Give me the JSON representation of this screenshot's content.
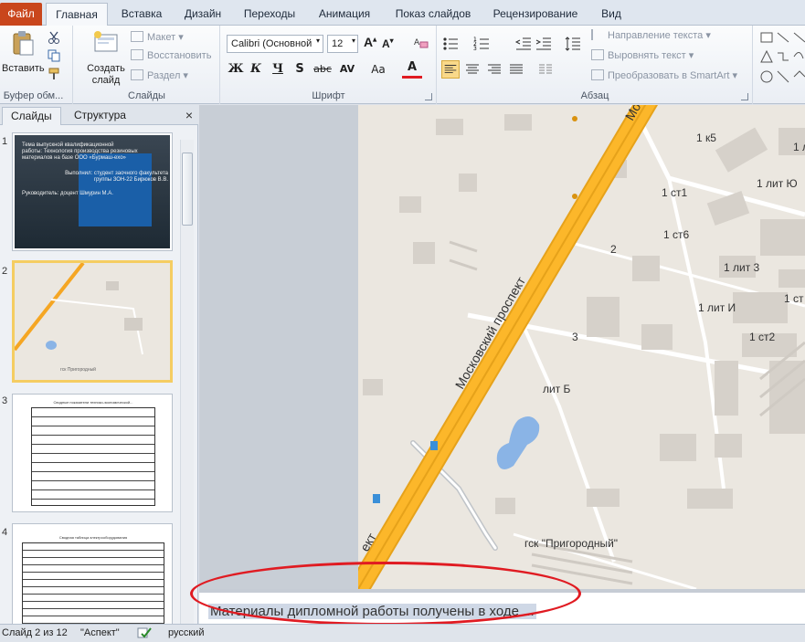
{
  "ribbon": {
    "tabs": [
      "Файл",
      "Главная",
      "Вставка",
      "Дизайн",
      "Переходы",
      "Анимация",
      "Показ слайдов",
      "Рецензирование",
      "Вид"
    ],
    "clipboard": {
      "paste": "Вставить",
      "label": "Буфер обм..."
    },
    "slides": {
      "new_slide": "Создать",
      "new_slide_2": "слайд",
      "layout": "Макет",
      "reset": "Восстановить",
      "section": "Раздел",
      "label": "Слайды"
    },
    "font": {
      "family": "Calibri (Основной",
      "size": "12",
      "label": "Шрифт",
      "bold": "Ж",
      "italic": "К",
      "underline": "Ч",
      "strike": "S",
      "abc": "abc",
      "av": "AV",
      "aa": "Aa",
      "a": "A"
    },
    "paragraph": {
      "text_direction": "Направление текста",
      "align_text": "Выровнять текст",
      "smartart": "Преобразовать в SmartArt",
      "label": "Абзац"
    }
  },
  "slides_pane": {
    "tab_slides": "Слайды",
    "tab_outline": "Структура",
    "close": "×",
    "thumbnails": [
      {
        "num": "1",
        "lines": [
          "Тема выпускной квалификационной",
          "работы: Технология производства резиновых",
          "материалов на базе ООО «Бурмаш-ехо»",
          "Выполнил: студент заочного факультета",
          "группы ЗОН-22 Бирюков В.В.",
          "Руководитель: доцент Шмурин М.А."
        ]
      },
      {
        "num": "2",
        "label": "гск Пригородный"
      },
      {
        "num": "3",
        "title": "Сводные показатели технико-экономической..."
      },
      {
        "num": "4",
        "title": "Сводная таблица электрооборудования"
      }
    ]
  },
  "map": {
    "street": "Московский проспект",
    "street_top": "Мо",
    "street_bottom": "ект",
    "labels": [
      "1 к5",
      "1 ст1",
      "1 лит Ю",
      "1 ст6",
      "2",
      "1 лит 3",
      "1 лит И",
      "1 ст",
      "3",
      "1 ст2",
      "лит Б",
      "1 л",
      "гск \"Пригородный\""
    ]
  },
  "notes": {
    "text": "Материалы дипломной работы получены в ходе ..."
  },
  "status": {
    "slide": "Слайд 2 из 12",
    "theme": "\"Аспект\"",
    "lang": "русский"
  }
}
